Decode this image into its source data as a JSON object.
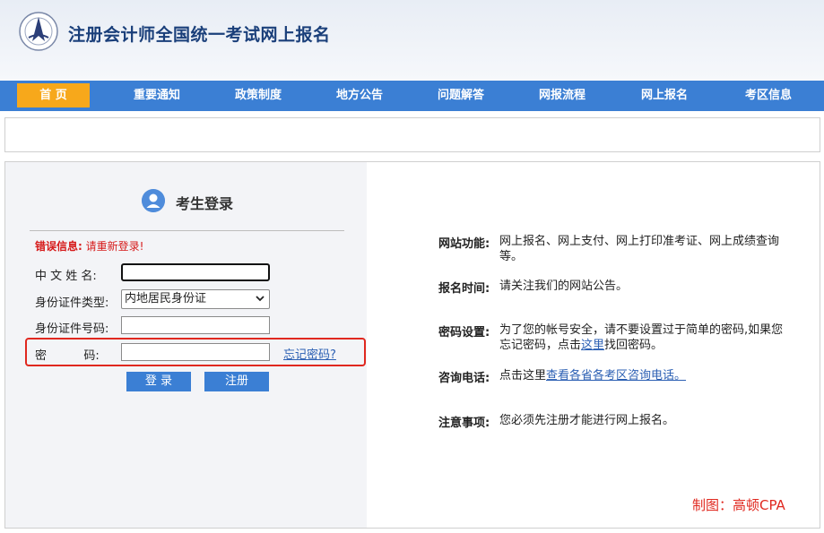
{
  "header": {
    "title": "注册会计师全国统一考试网上报名"
  },
  "nav": {
    "items": [
      {
        "label": "首 页",
        "active": true
      },
      {
        "label": "重要通知"
      },
      {
        "label": "政策制度"
      },
      {
        "label": "地方公告"
      },
      {
        "label": "问题解答"
      },
      {
        "label": "网报流程"
      },
      {
        "label": "网上报名"
      },
      {
        "label": "考区信息"
      }
    ]
  },
  "login": {
    "title": "考生登录",
    "error_label": "错误信息:",
    "error_text": "请重新登录!",
    "name_label": "中 文 姓 名:",
    "id_type_label": "身份证件类型:",
    "id_type_value": "内地居民身份证",
    "id_number_label": "身份证件号码:",
    "password_label": "密          码:",
    "forgot_link": "忘记密码?",
    "login_button": "登 录",
    "register_button": "注册"
  },
  "info": {
    "function_label": "网站功能:",
    "function_text": "网上报名、网上支付、网上打印准考证、网上成绩查询等。",
    "time_label": "报名时间:",
    "time_text": "请关注我们的网站公告。",
    "password_label": "密码设置:",
    "password_text_1": "为了您的帐号安全，请不要设置过于简单的密码,如果您忘记密码，点击",
    "password_link": "这里",
    "password_text_2": "找回密码。",
    "contact_label": "咨询电话:",
    "contact_text": "点击这里",
    "contact_link": "查看各省各考区咨询电话。",
    "notice_label": "注意事项:",
    "notice_text": "您必须先注册才能进行网上报名。"
  },
  "credit": "制图：高顿CPA",
  "colors": {
    "nav": "#3b7fd4",
    "active_tab": "#f7a81b",
    "error": "#e0281f"
  }
}
